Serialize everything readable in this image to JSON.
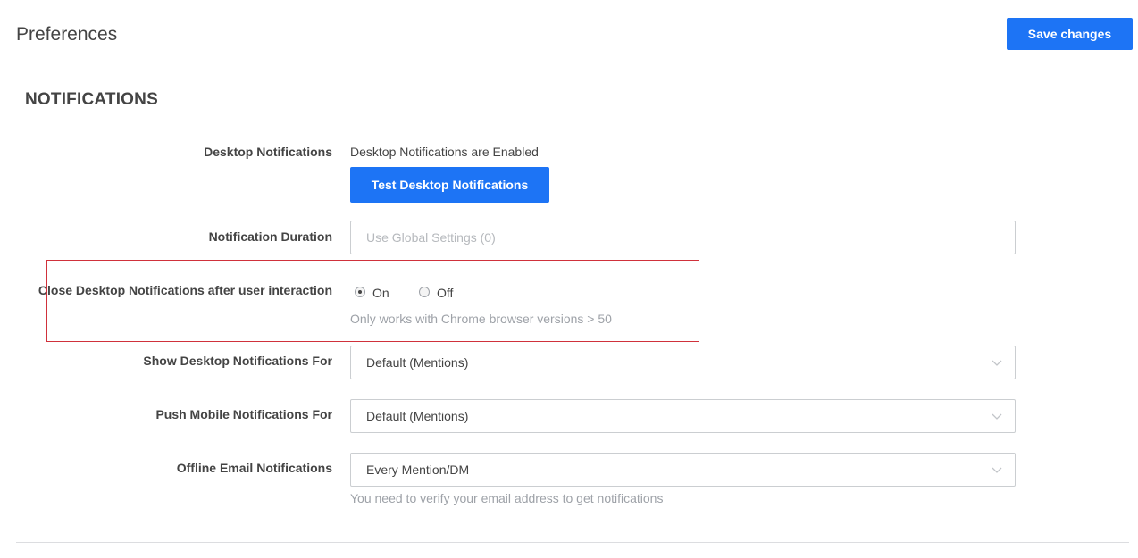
{
  "header": {
    "title": "Preferences",
    "save_label": "Save changes"
  },
  "section": {
    "title": "NOTIFICATIONS"
  },
  "desktop_notifications": {
    "label": "Desktop Notifications",
    "status": "Desktop Notifications are Enabled",
    "test_button_label": "Test Desktop Notifications"
  },
  "notification_duration": {
    "label": "Notification Duration",
    "placeholder": "Use Global Settings (0)",
    "value": ""
  },
  "close_after_interaction": {
    "label": "Close Desktop Notifications after user interaction",
    "options": [
      {
        "label": "On",
        "checked": true
      },
      {
        "label": "Off",
        "checked": false
      }
    ],
    "hint": "Only works with Chrome browser versions > 50"
  },
  "show_desktop_for": {
    "label": "Show Desktop Notifications For",
    "selected": "Default (Mentions)"
  },
  "push_mobile_for": {
    "label": "Push Mobile Notifications For",
    "selected": "Default (Mentions)"
  },
  "offline_email": {
    "label": "Offline Email Notifications",
    "selected": "Every Mention/DM",
    "hint": "You need to verify your email address to get notifications"
  },
  "icons": {
    "select_arrow": "chevron-down-icon"
  },
  "colors": {
    "primary": "#1d74f5",
    "highlight_border": "#d0313b",
    "hint_text": "#9ea2a8"
  }
}
